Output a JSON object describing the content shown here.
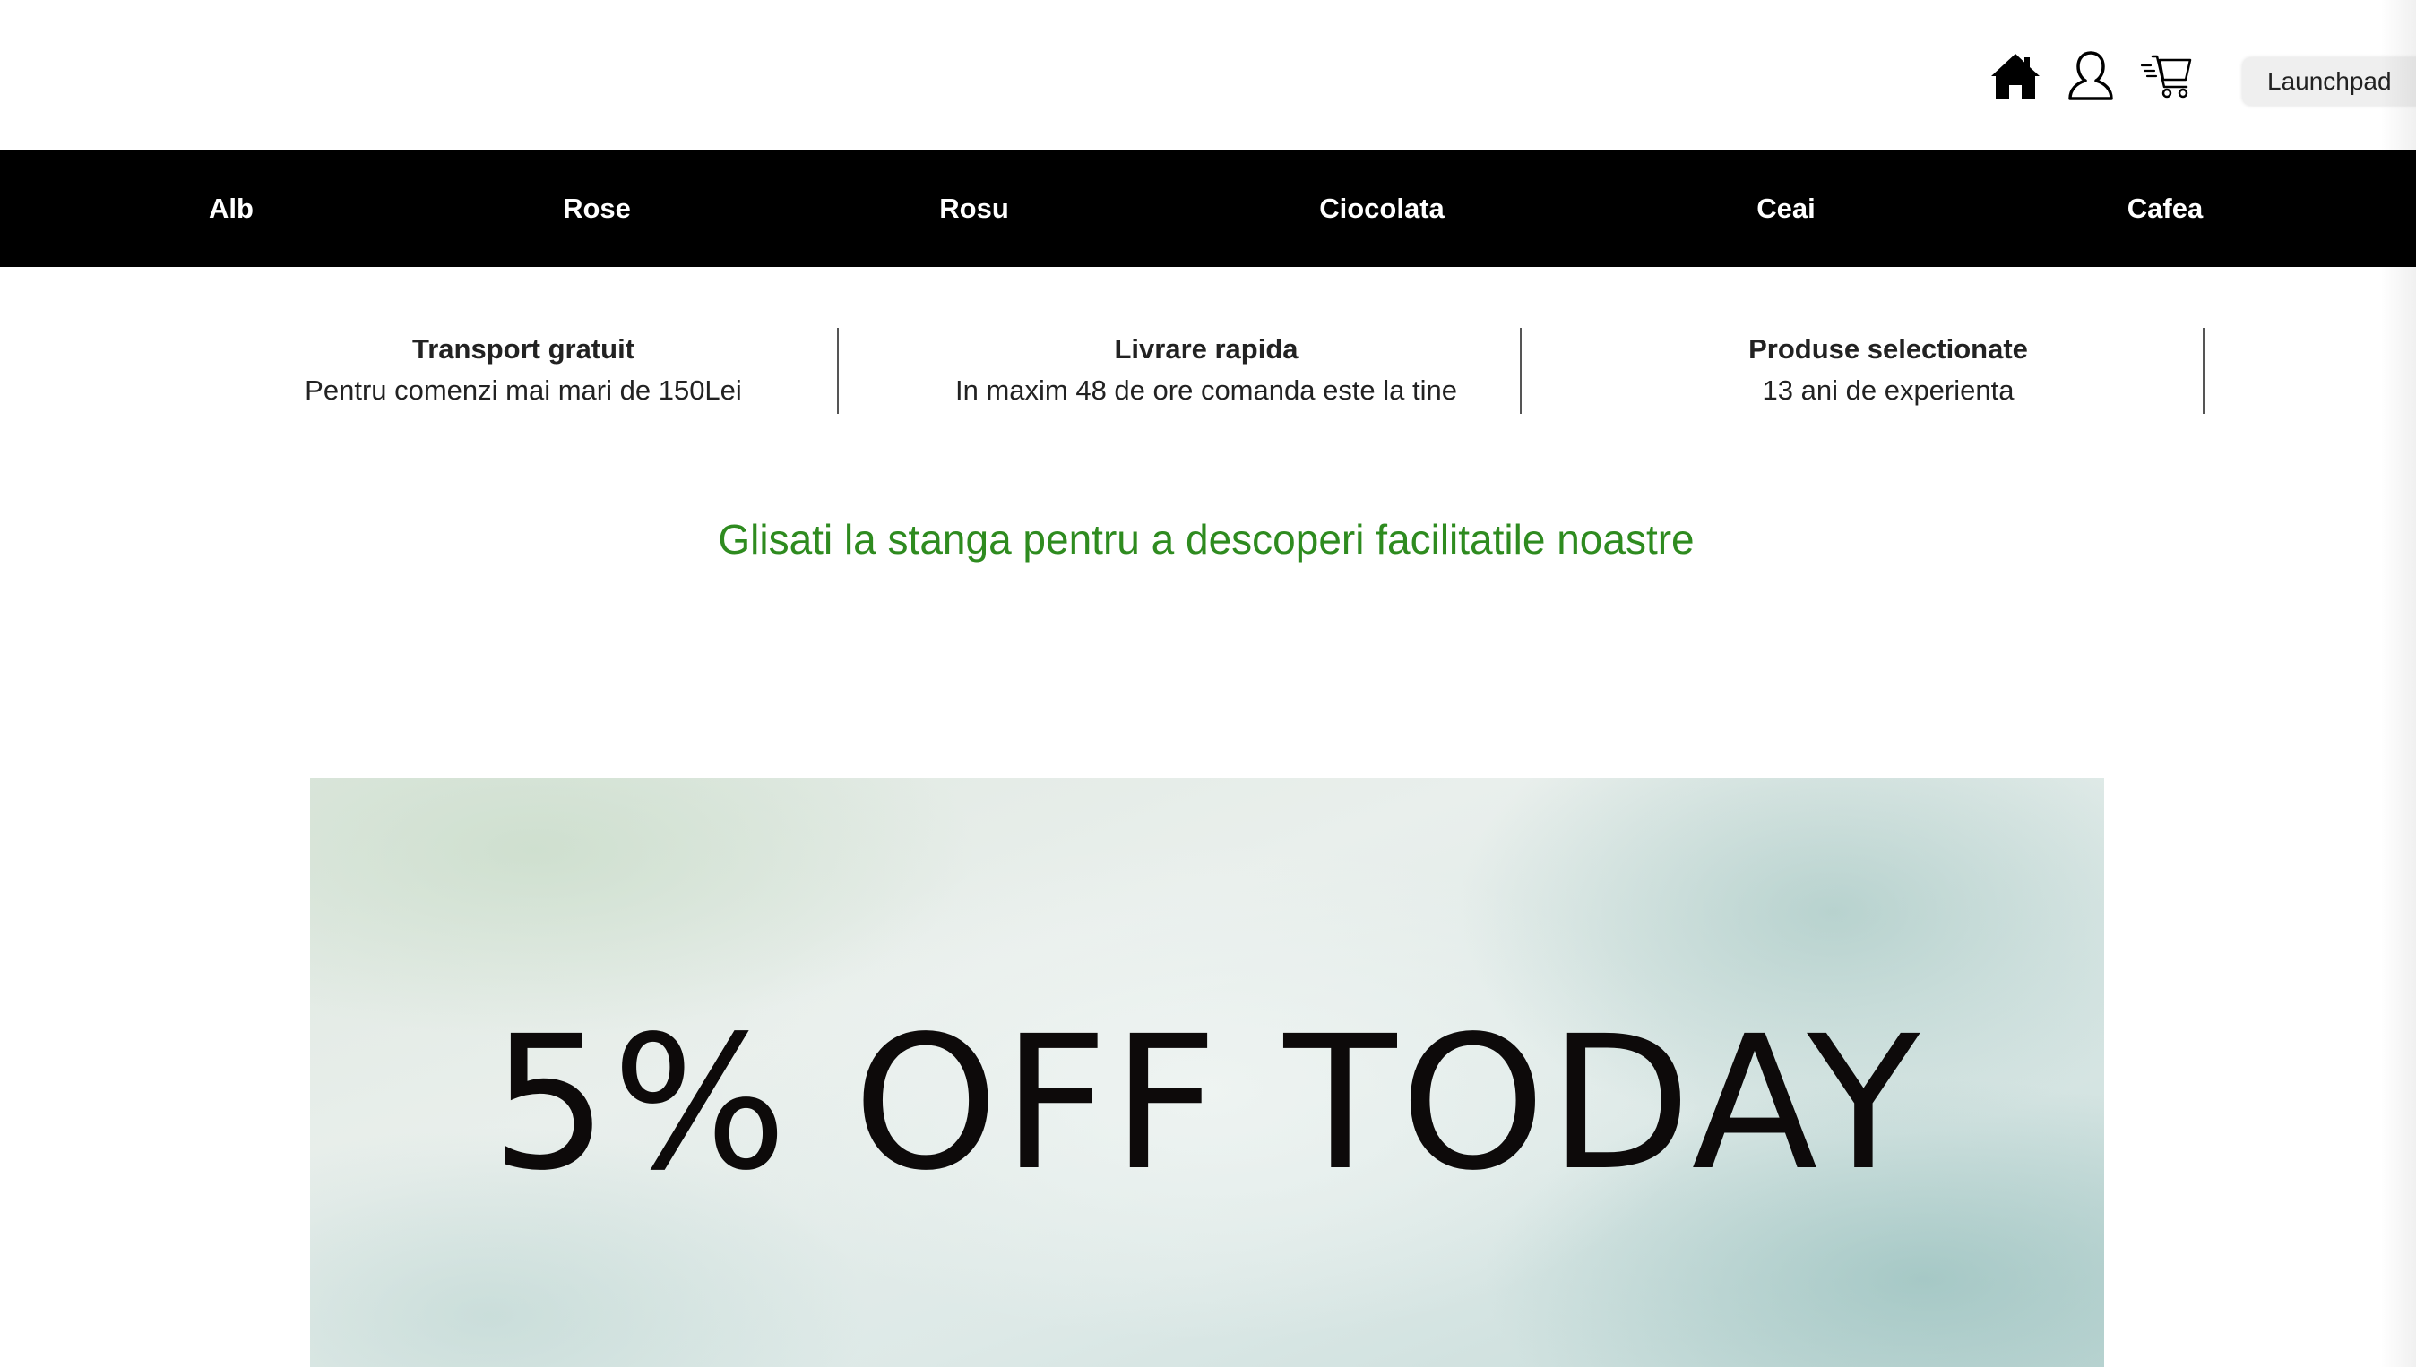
{
  "header": {
    "icons": [
      {
        "name": "home-icon"
      },
      {
        "name": "user-icon"
      },
      {
        "name": "cart-icon"
      }
    ],
    "launchpad_label": "Launchpad"
  },
  "nav": {
    "background": "#000000",
    "items": [
      {
        "label": "Alb"
      },
      {
        "label": "Rose"
      },
      {
        "label": "Rosu"
      },
      {
        "label": "Ciocolata"
      },
      {
        "label": "Ceai"
      },
      {
        "label": "Cafea"
      }
    ]
  },
  "features": [
    {
      "title": "Transport gratuit",
      "description": "Pentru comenzi mai mari de 150Lei"
    },
    {
      "title": "Livrare rapida",
      "description": "In maxim 48 de ore comanda este la tine"
    },
    {
      "title": "Produse selectionate",
      "description": "13 ani de experienta"
    }
  ],
  "swipe_message": {
    "text": "Glisati la stanga pentru a descoperi facilitatile noastre",
    "color": "#2e8b1f"
  },
  "banner": {
    "text": "5% OFF TODAY"
  }
}
